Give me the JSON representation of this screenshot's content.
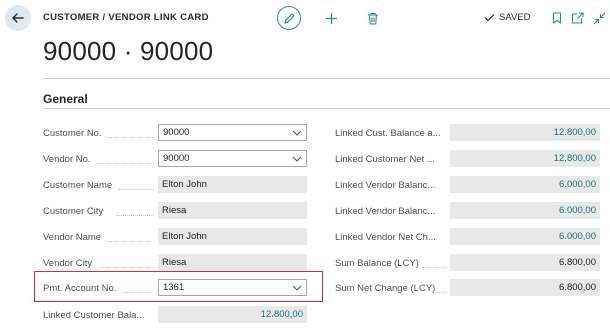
{
  "header": {
    "page_title": "CUSTOMER / VENDOR LINK CARD",
    "record_title": "90000 · 90000",
    "saved_label": "SAVED"
  },
  "section": {
    "title": "General"
  },
  "left_fields": [
    {
      "label": "Customer No.",
      "value": "90000"
    },
    {
      "label": "Vendor No.",
      "value": "90000"
    },
    {
      "label": "Customer Name",
      "value": "Elton John"
    },
    {
      "label": "Customer City",
      "value": "Riesa"
    },
    {
      "label": "Vendor Name",
      "value": "Elton John"
    },
    {
      "label": "Vendor City",
      "value": "Riesa"
    },
    {
      "label": "Pmt. Account No.",
      "value": "1361"
    },
    {
      "label": "Linked Customer Bala...",
      "value": "12.800,00"
    }
  ],
  "right_fields": [
    {
      "label": "Linked Cust. Balance a...",
      "value": "12.800,00"
    },
    {
      "label": "Linked Customer Net ...",
      "value": "12.800,00"
    },
    {
      "label": "Linked Vendor Balanc...",
      "value": "6.000,00"
    },
    {
      "label": "Linked Vendor Balanc...",
      "value": "6.000,00"
    },
    {
      "label": "Linked Vendor Net Ch...",
      "value": "6.000,00"
    },
    {
      "label": "Sum Balance (LCY)",
      "value": "6.800,00"
    },
    {
      "label": "Sum Net Change (LCY)",
      "value": "6.800,00"
    }
  ],
  "colors": {
    "accent": "#2b8c96",
    "link": "#14737e",
    "highlight": "#d32f2f"
  }
}
